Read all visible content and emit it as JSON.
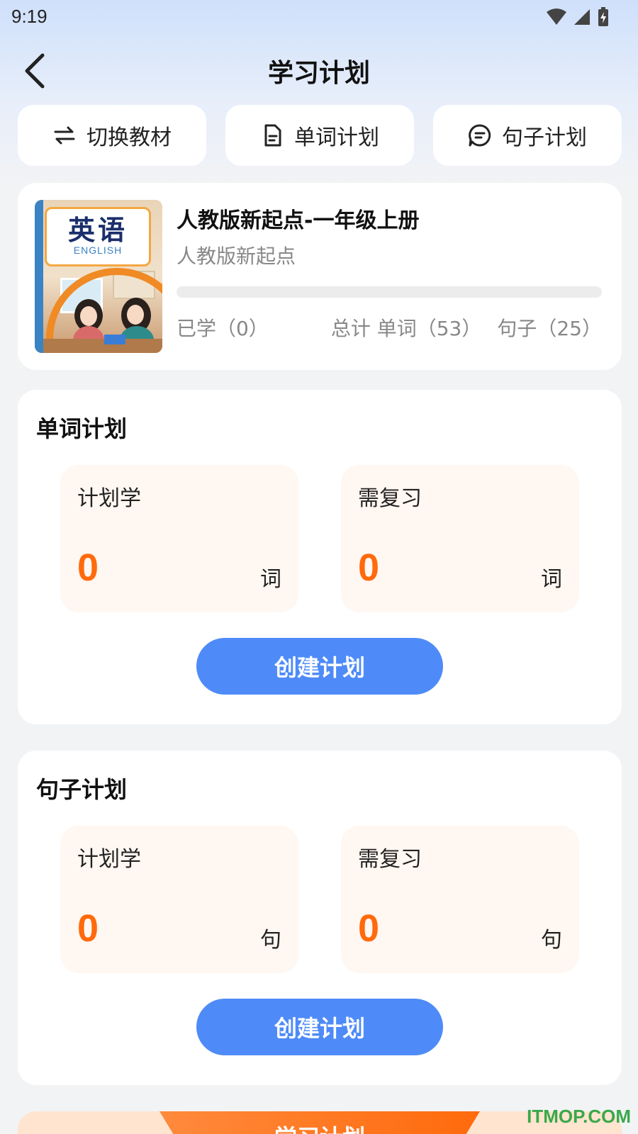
{
  "status_bar": {
    "time": "9:19"
  },
  "header": {
    "title": "学习计划"
  },
  "tabs": [
    {
      "label": "切换教材",
      "icon": "swap-icon"
    },
    {
      "label": "单词计划",
      "icon": "document-icon"
    },
    {
      "label": "句子计划",
      "icon": "chat-icon"
    }
  ],
  "book": {
    "cover_title": "英语",
    "cover_subtitle": "ENGLISH",
    "title": "人教版新起点-一年级上册",
    "series": "人教版新起点",
    "progress": 0,
    "learned": "已学（0）",
    "total_words": "总计 单词（53）",
    "total_sentences": "句子（25）"
  },
  "word_plan": {
    "title": "单词计划",
    "planned_label": "计划学",
    "planned_value": "0",
    "planned_unit": "词",
    "review_label": "需复习",
    "review_value": "0",
    "review_unit": "词",
    "button": "创建计划"
  },
  "sentence_plan": {
    "title": "句子计划",
    "planned_label": "计划学",
    "planned_value": "0",
    "planned_unit": "句",
    "review_label": "需复习",
    "review_value": "0",
    "review_unit": "句",
    "button": "创建计划"
  },
  "bottom_banner": {
    "label": "学习计划"
  },
  "watermark": "ITMOP.COM",
  "colors": {
    "accent": "#4e8bf8",
    "number": "#ff6a0c",
    "stat_bg": "#fff7f1"
  }
}
